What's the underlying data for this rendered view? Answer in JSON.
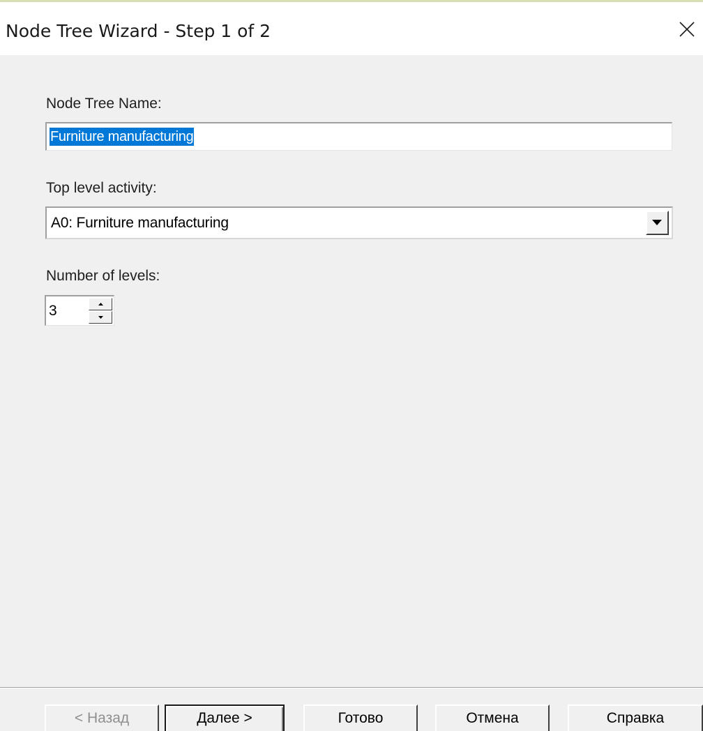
{
  "window": {
    "title": "Node Tree Wizard - Step 1 of 2",
    "close_icon": "close-icon"
  },
  "node_tree_name": {
    "label": "Node Tree Name:",
    "value": "Furniture manufacturing",
    "selected": true
  },
  "top_level_activity": {
    "label": "Top level activity:",
    "selected_value": "A0:  Furniture manufacturing",
    "arrow_icon": "chevron-down-icon"
  },
  "number_of_levels": {
    "label": "Number of levels:",
    "value": "3"
  },
  "buttons": {
    "back": "< Назад",
    "next": "Далее >",
    "finish": "Готово",
    "cancel": "Отмена",
    "help": "Справка"
  },
  "colors": {
    "selection_bg": "#0078d7",
    "dialog_bg": "#f0f0f0",
    "titlebar_bg": "#ffffff"
  }
}
